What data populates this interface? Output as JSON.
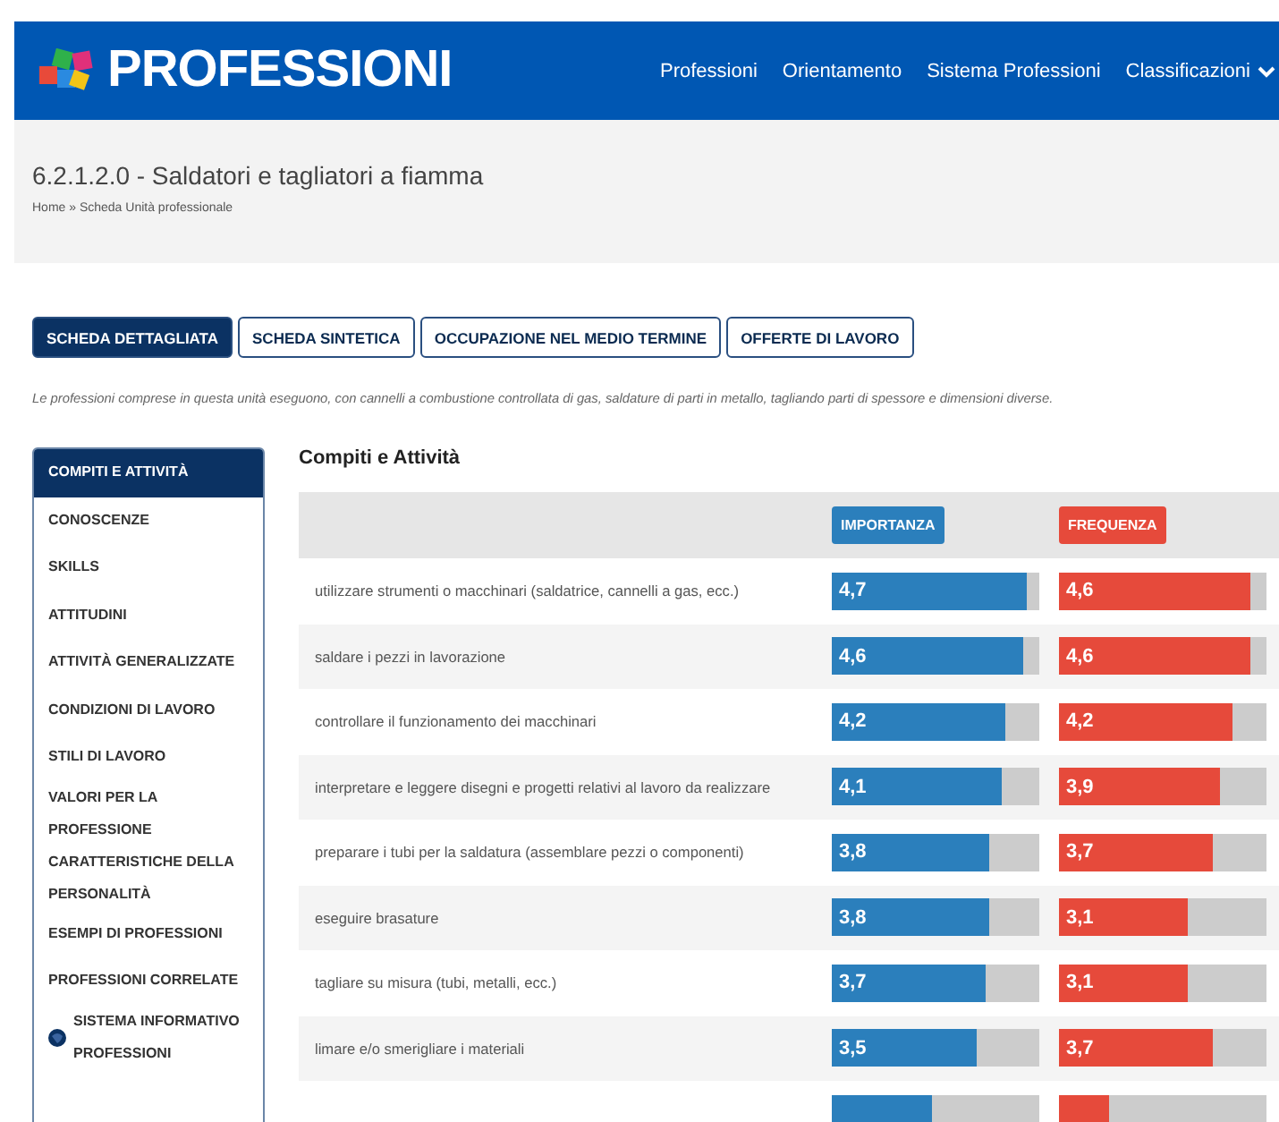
{
  "header": {
    "logo": "PROFESSIONI",
    "nav": [
      {
        "label": "Professioni",
        "dropdown": false
      },
      {
        "label": "Orientamento",
        "dropdown": false
      },
      {
        "label": "Sistema Professioni",
        "dropdown": false
      },
      {
        "label": "Classificazioni",
        "dropdown": true
      }
    ]
  },
  "page_title": "6.2.1.2.0 - Saldatori e tagliatori a fiamma",
  "breadcrumb": "Home » Scheda Unità professionale",
  "tabs": [
    {
      "label": "SCHEDA DETTAGLIATA",
      "selected": true
    },
    {
      "label": "SCHEDA SINTETICA",
      "selected": false
    },
    {
      "label": "OCCUPAZIONE NEL MEDIO TERMINE",
      "selected": false
    },
    {
      "label": "OFFERTE DI LAVORO",
      "selected": false
    }
  ],
  "description": "Le professioni comprese in questa unità eseguono, con cannelli a combustione controllata di gas, saldature di parti in metallo, tagliando parti di spessore e dimensioni diverse.",
  "sidebar": {
    "items": [
      {
        "label": "COMPITI E ATTIVITÀ",
        "selected": true,
        "kind": "link"
      },
      {
        "label": "CONOSCENZE",
        "selected": false,
        "kind": "link"
      },
      {
        "label": "SKILLS",
        "selected": false,
        "kind": "link"
      },
      {
        "label": "ATTITUDINI",
        "selected": false,
        "kind": "link"
      },
      {
        "label": "ATTIVITÀ GENERALIZZATE",
        "selected": false,
        "kind": "link"
      },
      {
        "label": "CONDIZIONI DI LAVORO",
        "selected": false,
        "kind": "link"
      },
      {
        "label": "STILI DI LAVORO",
        "selected": false,
        "kind": "link"
      },
      {
        "label": "VALORI PER LA PROFESSIONE",
        "selected": false,
        "kind": "link"
      },
      {
        "label": "CARATTERISTICHE DELLA PERSONALITÀ",
        "selected": false,
        "kind": "link"
      },
      {
        "label": "ESEMPI DI PROFESSIONI",
        "selected": false,
        "kind": "link"
      },
      {
        "label": "PROFESSIONI CORRELATE",
        "selected": false,
        "kind": "link"
      },
      {
        "label": "SISTEMA INFORMATIVO PROFESSIONI",
        "selected": false,
        "kind": "external"
      }
    ]
  },
  "section_title": "Compiti e Attività",
  "table": {
    "columns": [
      "IMPORTANZA",
      "FREQUENZA"
    ],
    "rows": [
      {
        "task": "utilizzare strumenti o macchinari (saldatrice, cannelli a gas, ecc.)",
        "importanza": {
          "value": "4,7",
          "level": 0.94
        },
        "frequenza": {
          "value": "4,6",
          "level": 0.92
        }
      },
      {
        "task": "saldare i pezzi in lavorazione",
        "importanza": {
          "value": "4,6",
          "level": 0.92
        },
        "frequenza": {
          "value": "4,6",
          "level": 0.92
        }
      },
      {
        "task": "controllare il funzionamento dei macchinari",
        "importanza": {
          "value": "4,2",
          "level": 0.84
        },
        "frequenza": {
          "value": "4,2",
          "level": 0.84
        }
      },
      {
        "task": "interpretare e leggere disegni e progetti relativi al lavoro da realizzare",
        "importanza": {
          "value": "4,1",
          "level": 0.82
        },
        "frequenza": {
          "value": "3,9",
          "level": 0.78
        }
      },
      {
        "task": "preparare i tubi per la saldatura (assemblare pezzi o componenti)",
        "importanza": {
          "value": "3,8",
          "level": 0.76
        },
        "frequenza": {
          "value": "3,7",
          "level": 0.74
        }
      },
      {
        "task": "eseguire brasature",
        "importanza": {
          "value": "3,8",
          "level": 0.76
        },
        "frequenza": {
          "value": "3,1",
          "level": 0.62
        }
      },
      {
        "task": "tagliare su misura (tubi, metalli, ecc.)",
        "importanza": {
          "value": "3,7",
          "level": 0.74
        },
        "frequenza": {
          "value": "3,1",
          "level": 0.62
        }
      },
      {
        "task": "limare e/o smerigliare i materiali",
        "importanza": {
          "value": "3,5",
          "level": 0.7
        },
        "frequenza": {
          "value": "3,7",
          "level": 0.74
        }
      },
      {
        "importanza": {
          "level": 0.48
        },
        "frequenza": {
          "level": 0.24
        }
      }
    ]
  }
}
